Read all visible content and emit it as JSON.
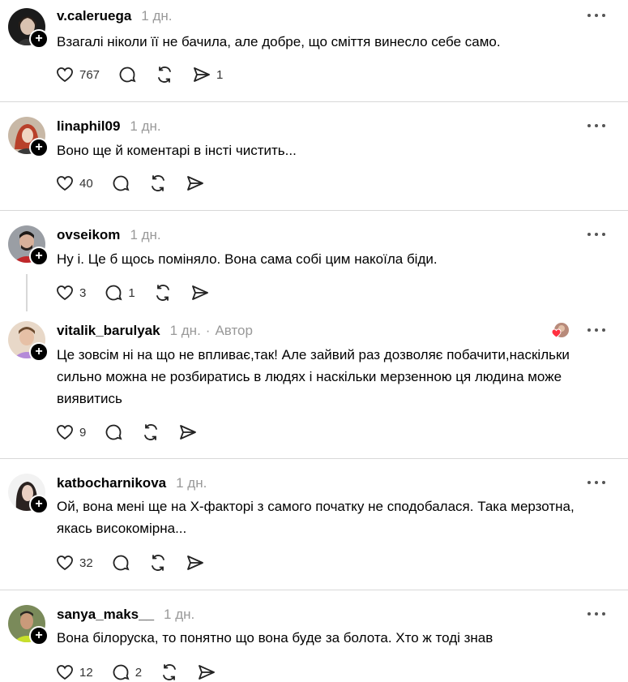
{
  "posts": [
    {
      "username": "v.caleruega",
      "time": "1 дн.",
      "text": "Взагалі ніколи її не бачила, але добре, що сміття винесло себе само.",
      "likes": "767",
      "replies": "",
      "reposts": "",
      "shares": "1"
    },
    {
      "username": "linaphil09",
      "time": "1 дн.",
      "text": "Воно ще й коментарі в інсті чистить...",
      "likes": "40",
      "replies": "",
      "reposts": "",
      "shares": ""
    },
    {
      "username": "ovseikom",
      "time": "1 дн.",
      "text": "Ну і. Це б щось поміняло. Вона сама собі цим накоїла біди.",
      "likes": "3",
      "replies": "1",
      "reposts": "",
      "shares": ""
    },
    {
      "username": "vitalik_barulyak",
      "time": "1 дн.",
      "author_sep": "·",
      "author_label": "Автор",
      "text": "Це зовсім ні на що не впливає,так! Але зайвий раз дозволяє побачити,наскільки сильно можна не розбиратись в людях і наскільки мерзенною ця людина може виявитись",
      "likes": "9",
      "replies": "",
      "reposts": "",
      "shares": ""
    },
    {
      "username": "katbocharnikova",
      "time": "1 дн.",
      "text": "Ой, вона мені ще на Х-факторі з самого початку не сподобалася. Така мерзотна, якась високомірна...",
      "likes": "32",
      "replies": "",
      "reposts": "",
      "shares": ""
    },
    {
      "username": "sanya_maks__",
      "time": "1 дн.",
      "text": "Вона білоруска, то понятно що вона буде за болота. Хто ж тоді знав",
      "likes": "12",
      "replies": "2",
      "reposts": "",
      "shares": ""
    }
  ],
  "icons": {
    "like": "heart-icon",
    "reply": "comment-icon",
    "repost": "repost-icon",
    "share": "share-icon",
    "follow": "plus-icon",
    "more": "more-icon"
  },
  "colors": {
    "text": "#000000",
    "muted": "#999999",
    "divider": "#d8d8d8",
    "heart_red": "#ff3040"
  }
}
